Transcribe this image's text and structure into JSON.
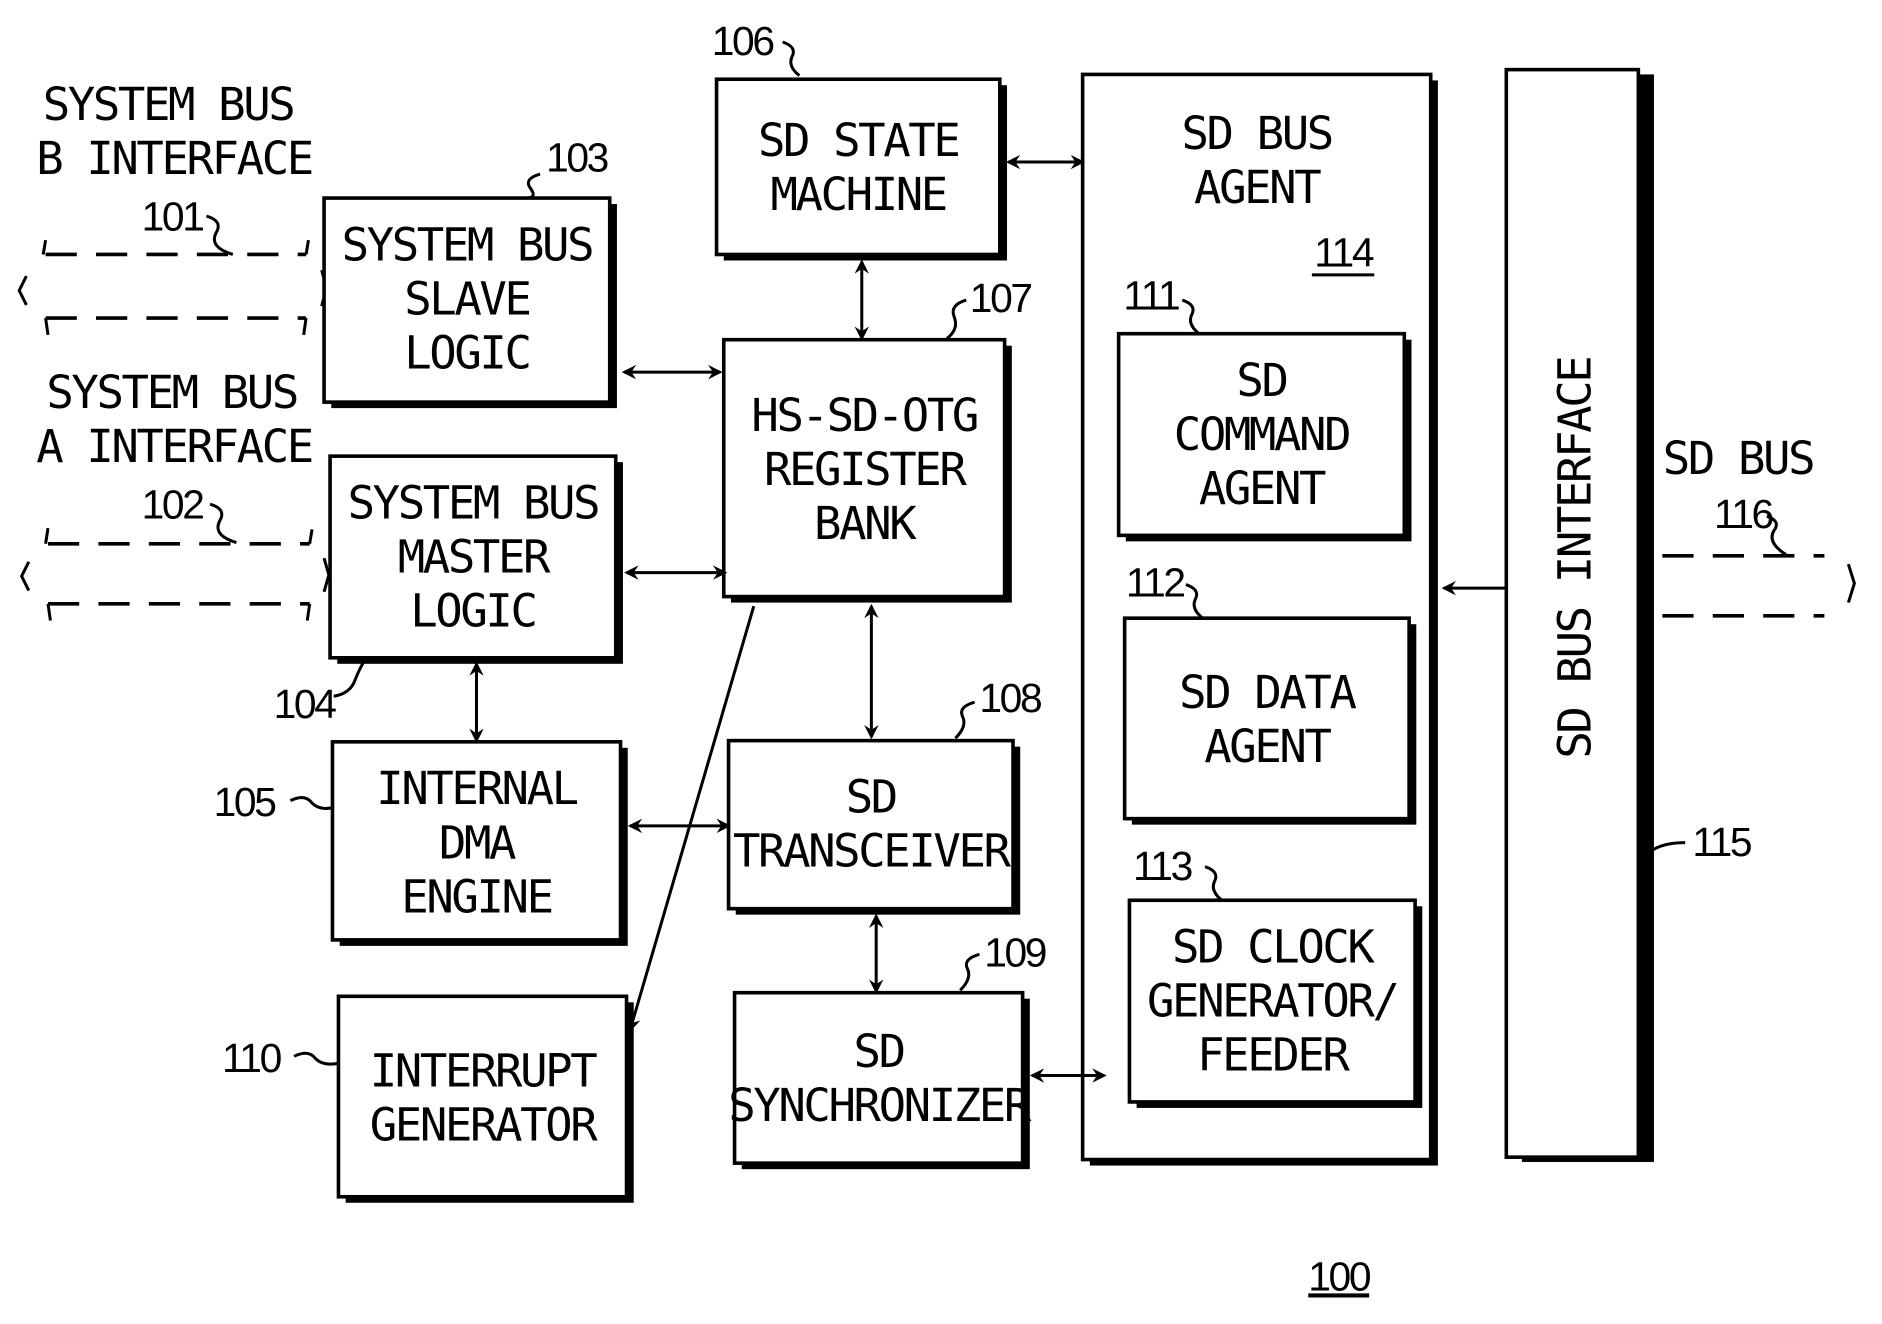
{
  "figure_number": "100",
  "blocks": {
    "slave": {
      "ref": "103",
      "lines": [
        "SYSTEM BUS",
        "SLAVE",
        "LOGIC"
      ]
    },
    "master": {
      "ref": "104",
      "lines": [
        "SYSTEM BUS",
        "MASTER",
        "LOGIC"
      ]
    },
    "dma": {
      "ref": "105",
      "lines": [
        "INTERNAL",
        "DMA",
        "ENGINE"
      ]
    },
    "interrupt": {
      "ref": "110",
      "lines": [
        "INTERRUPT",
        "GENERATOR"
      ]
    },
    "state_machine": {
      "ref": "106",
      "lines": [
        "SD STATE",
        "MACHINE"
      ]
    },
    "register_bank": {
      "ref": "107",
      "lines": [
        "HS-SD-OTG",
        "REGISTER",
        "BANK"
      ]
    },
    "transceiver": {
      "ref": "108",
      "lines": [
        "SD",
        "TRANSCEIVER"
      ]
    },
    "synchronizer": {
      "ref": "109",
      "lines": [
        "SD",
        "SYNCHRONIZER"
      ]
    },
    "bus_agent": {
      "ref": "114",
      "lines": [
        "SD BUS",
        "AGENT"
      ]
    },
    "command_agent": {
      "ref": "111",
      "lines": [
        "SD",
        "COMMAND",
        "AGENT"
      ]
    },
    "data_agent": {
      "ref": "112",
      "lines": [
        "SD DATA",
        "AGENT"
      ]
    },
    "clock_gen": {
      "ref": "113",
      "lines": [
        "SD CLOCK",
        "GENERATOR/",
        "FEEDER"
      ]
    },
    "bus_interface": {
      "ref": "115",
      "label": "SD BUS INTERFACE"
    }
  },
  "interfaces": {
    "sys_b": {
      "ref": "101",
      "lines": [
        "SYSTEM BUS",
        "B INTERFACE"
      ]
    },
    "sys_a": {
      "ref": "102",
      "lines": [
        "SYSTEM BUS",
        "A INTERFACE"
      ]
    },
    "sd_bus": {
      "ref": "116",
      "lines": [
        "SD BUS"
      ]
    }
  }
}
